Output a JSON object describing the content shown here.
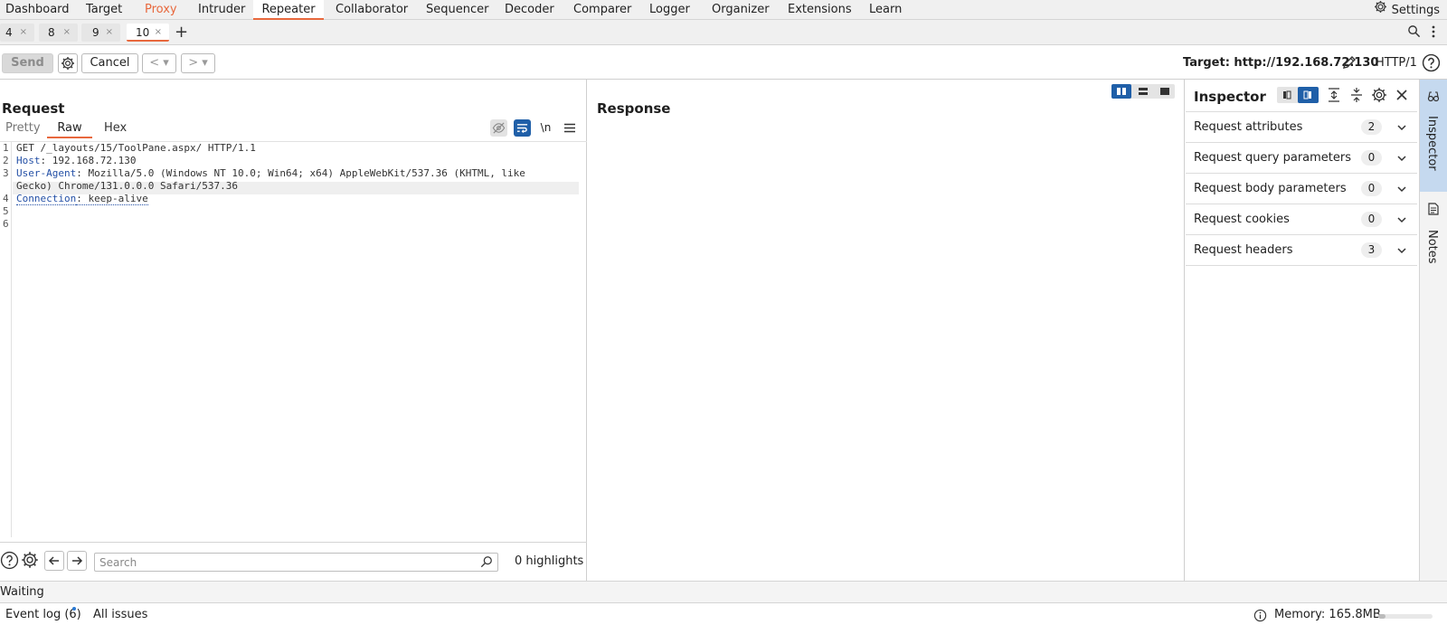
{
  "topnav": {
    "tabs": [
      "Dashboard",
      "Target",
      "Proxy",
      "Intruder",
      "Repeater",
      "Collaborator",
      "Sequencer",
      "Decoder",
      "Comparer",
      "Logger",
      "Organizer",
      "Extensions",
      "Learn"
    ],
    "active": "Repeater",
    "settings_label": "Settings"
  },
  "repeater_tabs": {
    "tabs": [
      {
        "label": "4",
        "close": "×"
      },
      {
        "label": "8",
        "close": "×"
      },
      {
        "label": "9",
        "close": "×"
      },
      {
        "label": "10",
        "close": "×"
      }
    ],
    "active": "10",
    "add": "+"
  },
  "toolbar": {
    "send": "Send",
    "cancel": "Cancel",
    "back": "< ▾",
    "forward": "> ▾",
    "target": "Target: http://192.168.72.130",
    "http_version": "HTTP/1"
  },
  "request": {
    "title": "Request",
    "view_tabs": [
      "Pretty",
      "Raw",
      "Hex"
    ],
    "active_view": "Raw",
    "newline_toggle": "\\n",
    "lines": [
      {
        "n": "1",
        "text": "GET /_layouts/15/ToolPane.aspx/ HTTP/1.1"
      },
      {
        "n": "2",
        "name": "Host",
        "value": ": 192.168.72.130"
      },
      {
        "n": "3",
        "name": "User-Agent",
        "value": ": Mozilla/5.0 (Windows NT 10.0; Win64; x64) AppleWebKit/537.36 (KHTML, like",
        "wrap": "Gecko) Chrome/131.0.0.0 Safari/537.36"
      },
      {
        "n": "4",
        "name": "Connection",
        "value": ": keep-alive"
      },
      {
        "n": "5",
        "text": ""
      },
      {
        "n": "6",
        "text": ""
      }
    ],
    "search_placeholder": "Search",
    "highlights": "0 highlights"
  },
  "response": {
    "title": "Response"
  },
  "inspector": {
    "title": "Inspector",
    "rows": [
      {
        "label": "Request attributes",
        "count": "2"
      },
      {
        "label": "Request query parameters",
        "count": "0"
      },
      {
        "label": "Request body parameters",
        "count": "0"
      },
      {
        "label": "Request cookies",
        "count": "0"
      },
      {
        "label": "Request headers",
        "count": "3"
      }
    ]
  },
  "siderail": {
    "inspector": "Inspector",
    "notes": "Notes"
  },
  "status": {
    "waiting": "Waiting",
    "event_log": "Event log (6)",
    "all_issues": "All issues",
    "memory": "Memory: 165.8MB",
    "memory_fraction": 0.13
  },
  "colors": {
    "accent": "#e8683d",
    "active_blue": "#1f5fa8",
    "header_name": "#2450a6"
  }
}
